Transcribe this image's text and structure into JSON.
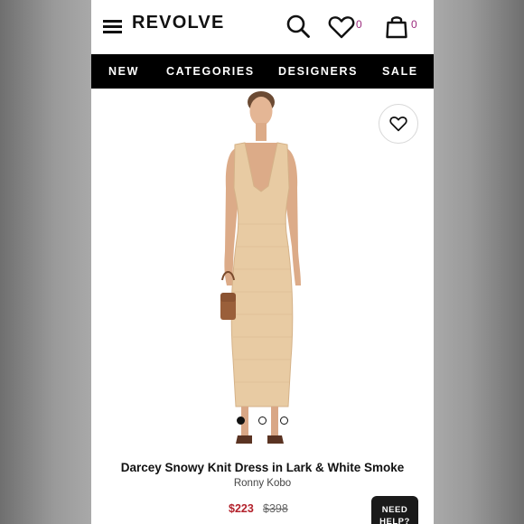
{
  "header": {
    "logo": "REVOLVE",
    "wishlist_count": "0",
    "bag_count": "0"
  },
  "nav": [
    "NEW",
    "CATEGORIES",
    "DESIGNERS",
    "SALE"
  ],
  "product": {
    "title": "Darcey Snowy Knit Dress in Lark & White Smoke",
    "brand": "Ronny Kobo",
    "price": "$223",
    "original_price": "$398",
    "image_count": 3,
    "active_image": 1
  },
  "help_button": {
    "label": "NEED HELP?"
  },
  "colors": {
    "accent_badge": "#9c2a7d",
    "sale_price": "#b3222c",
    "nav_background": "#000000",
    "dress": "#e8cba3"
  }
}
